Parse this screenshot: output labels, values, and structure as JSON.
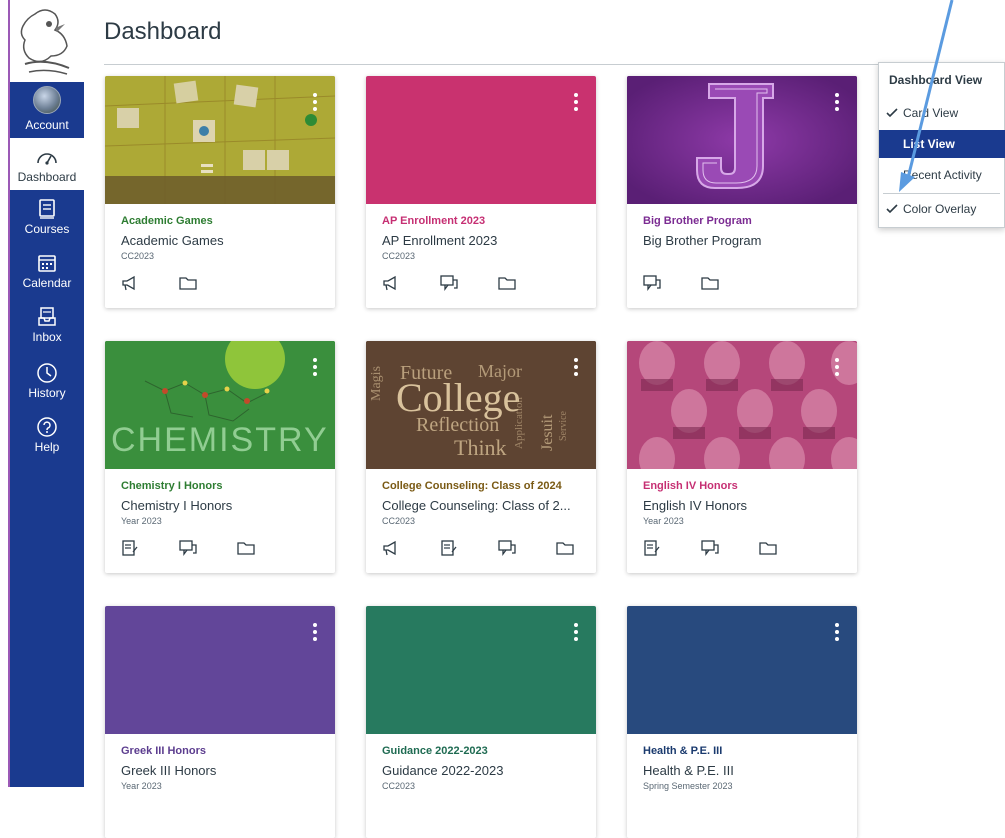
{
  "page": {
    "title": "Dashboard"
  },
  "nav": {
    "items": [
      {
        "label": "Account",
        "icon": "avatar-icon"
      },
      {
        "label": "Dashboard",
        "icon": "dashboard-icon"
      },
      {
        "label": "Courses",
        "icon": "courses-icon"
      },
      {
        "label": "Calendar",
        "icon": "calendar-icon"
      },
      {
        "label": "Inbox",
        "icon": "inbox-icon"
      },
      {
        "label": "History",
        "icon": "history-icon"
      },
      {
        "label": "Help",
        "icon": "help-icon"
      }
    ]
  },
  "menu": {
    "heading": "Dashboard View",
    "items": [
      {
        "label": "Card View",
        "checked": true
      },
      {
        "label": "List View",
        "checked": false
      },
      {
        "label": "Recent Activity",
        "checked": false
      },
      {
        "label": "Color Overlay",
        "checked": true
      }
    ]
  },
  "cards": [
    {
      "code": "Academic Games",
      "name": "Academic Games",
      "term": "CC2023",
      "color": "#2e7d32",
      "hero": "#c8b838",
      "icons": [
        "announcement-icon",
        "folder-icon"
      ]
    },
    {
      "code": "AP Enrollment 2023",
      "name": "AP Enrollment 2023",
      "term": "CC2023",
      "color": "#c62f73",
      "hero": "#c9326f",
      "icons": [
        "announcement-icon",
        "discussion-icon",
        "folder-icon"
      ]
    },
    {
      "code": "Big Brother Program",
      "name": "Big Brother Program",
      "term": "",
      "color": "#7b2b92",
      "hero": "#7b2b92",
      "icons": [
        "discussion-icon",
        "folder-icon"
      ]
    },
    {
      "code": "Chemistry I Honors",
      "name": "Chemistry I Honors",
      "term": "Year 2023",
      "color": "#2e7d32",
      "hero": "#3a8f3d",
      "icons": [
        "assignment-icon",
        "discussion-icon",
        "folder-icon"
      ]
    },
    {
      "code": "College Counseling: Class of 2024",
      "name": "College Counseling: Class of 2...",
      "term": "CC2023",
      "color": "#7a5a14",
      "hero": "#5e4432",
      "icons": [
        "announcement-icon",
        "assignment-icon",
        "discussion-icon",
        "folder-icon"
      ]
    },
    {
      "code": "English IV Honors",
      "name": "English IV Honors",
      "term": "Year 2023",
      "color": "#c62f73",
      "hero": "#b5477a",
      "icons": [
        "assignment-icon",
        "discussion-icon",
        "folder-icon"
      ]
    },
    {
      "code": "Greek III Honors",
      "name": "Greek III Honors",
      "term": "Year 2023",
      "color": "#5c3d8f",
      "hero": "#624699",
      "icons": []
    },
    {
      "code": "Guidance 2022-2023",
      "name": "Guidance 2022-2023",
      "term": "CC2023",
      "color": "#1f6b52",
      "hero": "#277a5f",
      "icons": []
    },
    {
      "code": "Health & P.E. III",
      "name": "Health & P.E. III",
      "term": "Spring Semester 2023",
      "color": "#1a3a6e",
      "hero": "#284a7e",
      "icons": []
    }
  ]
}
